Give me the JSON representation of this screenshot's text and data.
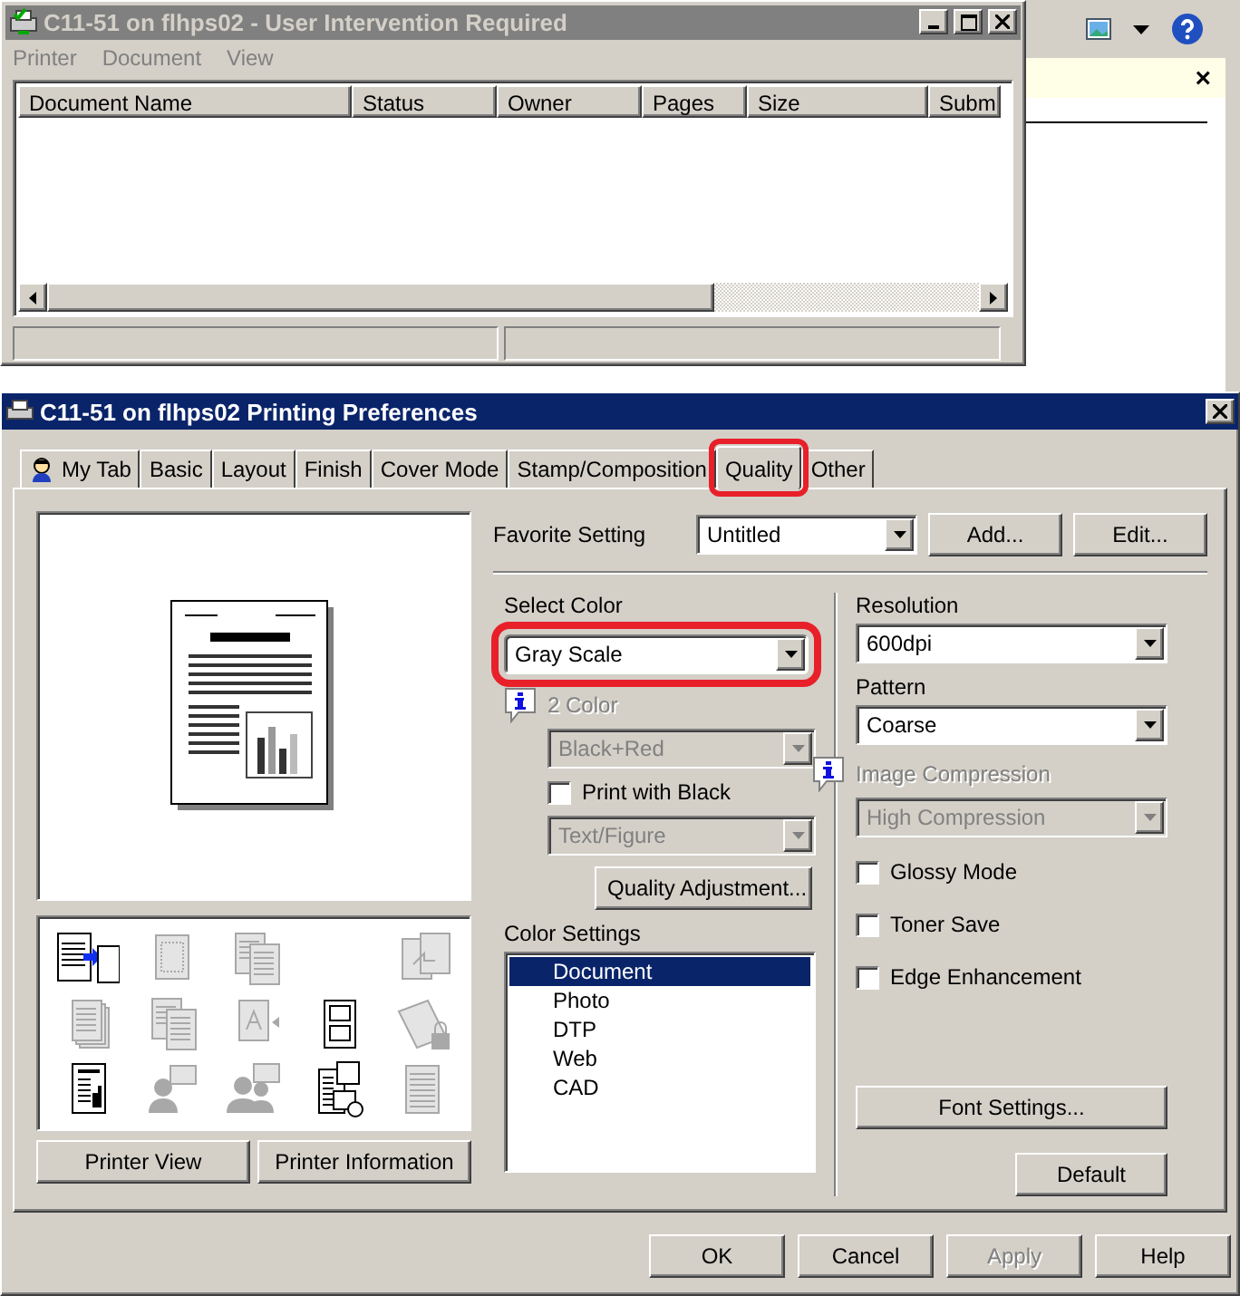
{
  "queue_window": {
    "title": "C11-51 on flhps02 - User Intervention Required",
    "active": false,
    "menu": [
      "Printer",
      "Document",
      "View"
    ],
    "columns": [
      "Document Name",
      "Status",
      "Owner",
      "Pages",
      "Size",
      "Subm"
    ]
  },
  "background_app": {
    "banner_close": "×"
  },
  "dialog": {
    "title": "C11-51 on flhps02 Printing Preferences",
    "tabs": [
      {
        "label": "My Tab",
        "selected": false,
        "highlighted": false
      },
      {
        "label": "Basic",
        "selected": false,
        "highlighted": false
      },
      {
        "label": "Layout",
        "selected": false,
        "highlighted": false
      },
      {
        "label": "Finish",
        "selected": false,
        "highlighted": false
      },
      {
        "label": "Cover Mode",
        "selected": false,
        "highlighted": false
      },
      {
        "label": "Stamp/Composition",
        "selected": false,
        "highlighted": false
      },
      {
        "label": "Quality",
        "selected": true,
        "highlighted": true
      },
      {
        "label": "Other",
        "selected": false,
        "highlighted": false
      }
    ],
    "function_icons": [
      {
        "kind": "printer-output",
        "disabled": false
      },
      {
        "kind": "page-grid",
        "disabled": true
      },
      {
        "kind": "documents",
        "disabled": true
      },
      {
        "kind": "blank"
      },
      {
        "kind": "page-return",
        "disabled": true
      },
      {
        "kind": "document-stack",
        "disabled": true
      },
      {
        "kind": "documents",
        "disabled": true
      },
      {
        "kind": "letter-page",
        "disabled": true
      },
      {
        "kind": "framed-page",
        "disabled": false
      },
      {
        "kind": "locked-page",
        "disabled": true
      },
      {
        "kind": "chart-page",
        "disabled": false
      },
      {
        "kind": "person",
        "disabled": true
      },
      {
        "kind": "people",
        "disabled": true
      },
      {
        "kind": "calendar-page",
        "disabled": false
      },
      {
        "kind": "banner-page",
        "disabled": true
      }
    ],
    "preview_buttons": [
      "Printer View",
      "Printer Information"
    ],
    "favorite_setting": {
      "label": "Favorite Setting",
      "value": "Untitled",
      "buttons": [
        "Add...",
        "Edit..."
      ]
    },
    "select_color": {
      "label": "Select Color",
      "value": "Gray Scale",
      "highlighted": true
    },
    "two_color": {
      "label": "2 Color",
      "value": "Black+Red",
      "disabled": true
    },
    "print_with_black": {
      "label": "Print with Black",
      "checked": false
    },
    "text_figure": {
      "value": "Text/Figure",
      "disabled": true
    },
    "quality_adjustment": "Quality Adjustment...",
    "color_settings": {
      "label": "Color Settings",
      "items": [
        {
          "label": "Document",
          "selected": true
        },
        {
          "label": "Photo",
          "selected": false
        },
        {
          "label": "DTP",
          "selected": false
        },
        {
          "label": "Web",
          "selected": false
        },
        {
          "label": "CAD",
          "selected": false
        }
      ]
    },
    "resolution": {
      "label": "Resolution",
      "value": "600dpi"
    },
    "pattern": {
      "label": "Pattern",
      "value": "Coarse"
    },
    "image_compression": {
      "label": "Image Compression",
      "value": "High Compression",
      "disabled": true
    },
    "checkboxes": [
      {
        "label": "Glossy Mode",
        "checked": false
      },
      {
        "label": "Toner Save",
        "checked": false
      },
      {
        "label": "Edge Enhancement",
        "checked": false
      }
    ],
    "font_settings": "Font Settings...",
    "default_button": "Default",
    "buttons": [
      {
        "label": "OK",
        "disabled": false
      },
      {
        "label": "Cancel",
        "disabled": false
      },
      {
        "label": "Apply",
        "disabled": true
      },
      {
        "label": "Help",
        "disabled": false
      }
    ]
  }
}
